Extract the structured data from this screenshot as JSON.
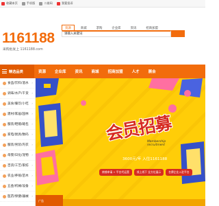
{
  "topbar": {
    "links": [
      {
        "label": "收藏本页",
        "icon": "bookmark-icon"
      },
      {
        "label": "手机版",
        "icon": "mobile-icon"
      },
      {
        "label": "二维码",
        "icon": "qrcode-icon"
      },
      {
        "label": "我要投诉",
        "icon": "complaint-icon"
      }
    ]
  },
  "logo": {
    "number": "1161188",
    "slogan": "采购批发上 1161188.com"
  },
  "search": {
    "tabs": [
      "资源",
      "商城",
      "求购",
      "企业库",
      "资讯",
      "招商加盟"
    ],
    "active_tab": 0,
    "input_value": "请输入关键词"
  },
  "navbar": {
    "category_label": "精选品类",
    "items": [
      "资源",
      "企业库",
      "资讯",
      "商城",
      "招商加盟",
      "人才",
      "展会"
    ]
  },
  "sidebar": {
    "items": [
      "食品/饮料/酒水",
      "调味/水产/干货",
      "美食/餐饮/小吃",
      "建材/家居/园林",
      "服装/鞋帽/箱包",
      "家电/厨具/数码",
      "服装/男装/内衣",
      "母婴/日化/宠物",
      "百货/工艺/家纺",
      "农业/养殖/苗木",
      "五金/机械/设备",
      "医药/保健/器械"
    ]
  },
  "banner": {
    "headline": "会员招募",
    "subtitle_en": [
      "Membership",
      "recruitment"
    ],
    "tagline": "3600元/年 入住1161188",
    "pills": [
      "商铺申请 + 平台代运营",
      "线上线下 全方位展示",
      "名牌企业入驻平台"
    ],
    "ad_label": "广告"
  },
  "colors": {
    "brand_orange": "#f26c0c",
    "banner_yellow": "#ffcd08",
    "headline_red": "#d62b21"
  }
}
